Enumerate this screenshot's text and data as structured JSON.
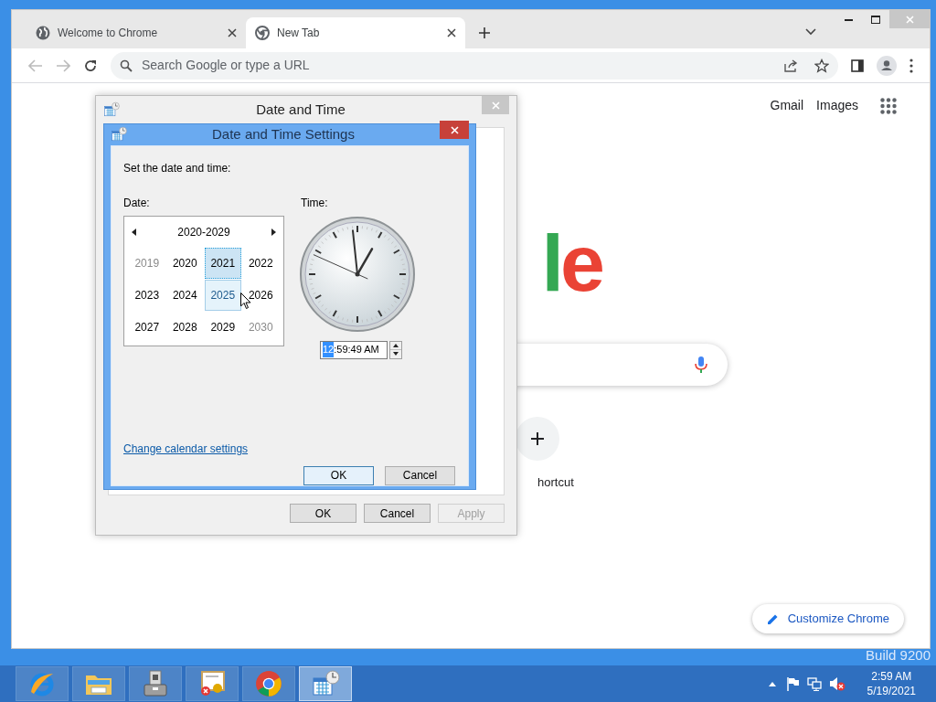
{
  "browser": {
    "tabs": [
      {
        "title": "Welcome to Chrome",
        "kind": "globe",
        "selected": false
      },
      {
        "title": "New Tab",
        "kind": "chrome",
        "selected": true
      }
    ],
    "omnibox": {
      "placeholder": "Search Google or type a URL"
    }
  },
  "page": {
    "header_links": [
      "Gmail",
      "Images"
    ],
    "logo_fragment": "le",
    "shortcut_label": "hortcut",
    "customize_button": "Customize Chrome"
  },
  "date_time_dialog": {
    "title": "Date and Time",
    "buttons": [
      {
        "label": "OK",
        "disabled": false
      },
      {
        "label": "Cancel",
        "disabled": false
      },
      {
        "label": "Apply",
        "disabled": true
      }
    ]
  },
  "settings_dialog": {
    "title": "Date and Time Settings",
    "prompt": "Set the date and time:",
    "date_label": "Date:",
    "time_label": "Time:",
    "calendar": {
      "range": "2020-2029",
      "years": [
        {
          "label": "2019",
          "dimmed": true,
          "selected": false,
          "hovered": false
        },
        {
          "label": "2020",
          "dimmed": false,
          "selected": false,
          "hovered": false
        },
        {
          "label": "2021",
          "dimmed": false,
          "selected": true,
          "hovered": false
        },
        {
          "label": "2022",
          "dimmed": false,
          "selected": false,
          "hovered": false
        },
        {
          "label": "2023",
          "dimmed": false,
          "selected": false,
          "hovered": false
        },
        {
          "label": "2024",
          "dimmed": false,
          "selected": false,
          "hovered": false
        },
        {
          "label": "2025",
          "dimmed": false,
          "selected": false,
          "hovered": true
        },
        {
          "label": "2026",
          "dimmed": false,
          "selected": false,
          "hovered": false
        },
        {
          "label": "2027",
          "dimmed": false,
          "selected": false,
          "hovered": false
        },
        {
          "label": "2028",
          "dimmed": false,
          "selected": false,
          "hovered": false
        },
        {
          "label": "2029",
          "dimmed": false,
          "selected": false,
          "hovered": false
        },
        {
          "label": "2030",
          "dimmed": true,
          "selected": false,
          "hovered": false
        }
      ]
    },
    "time_field": {
      "selected_part": "12",
      "rest": ":59:49 AM"
    },
    "link": "Change calendar settings",
    "buttons": [
      {
        "label": "OK",
        "default": true
      },
      {
        "label": "Cancel",
        "default": false
      }
    ]
  },
  "desktop": {
    "build_text": "Build 9200"
  },
  "taskbar": {
    "apps": [
      {
        "kind": "ie",
        "active": false
      },
      {
        "kind": "folder",
        "active": false
      },
      {
        "kind": "server",
        "active": false
      },
      {
        "kind": "certificate",
        "active": false
      },
      {
        "kind": "chrome",
        "active": false
      },
      {
        "kind": "calendar",
        "active": true
      }
    ],
    "clock": {
      "time": "2:59 AM",
      "date": "5/19/2021"
    }
  }
}
